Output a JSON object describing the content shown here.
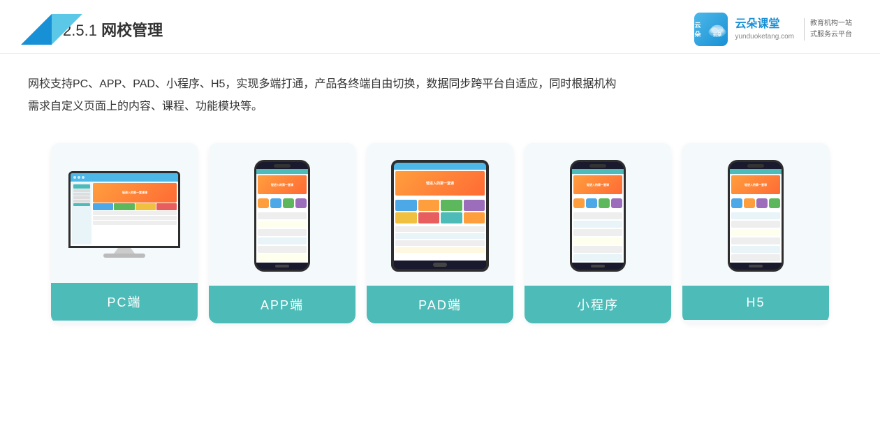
{
  "header": {
    "section": "2.5.1",
    "title": "网校管理",
    "brand": {
      "name": "云朵课堂",
      "url": "yunduoketang.com",
      "slogan_line1": "教育机构一站",
      "slogan_line2": "式服务云平台"
    }
  },
  "description": {
    "text_line1": "网校支持PC、APP、PAD、小程序、H5，实现多端打通，产品各终端自由切换，数据同步跨平台自适应，同时根据机构",
    "text_line2": "需求自定义页面上的内容、课程、功能模块等。"
  },
  "cards": [
    {
      "id": "pc",
      "label": "PC端",
      "type": "pc"
    },
    {
      "id": "app",
      "label": "APP端",
      "type": "phone"
    },
    {
      "id": "pad",
      "label": "PAD端",
      "type": "pad"
    },
    {
      "id": "miniprogram",
      "label": "小程序",
      "type": "phone"
    },
    {
      "id": "h5",
      "label": "H5",
      "type": "phone"
    }
  ],
  "colors": {
    "accent": "#4dbcb8",
    "teal": "#4dbcb8",
    "orange": "#ff9e3d",
    "blue": "#1890d5"
  }
}
